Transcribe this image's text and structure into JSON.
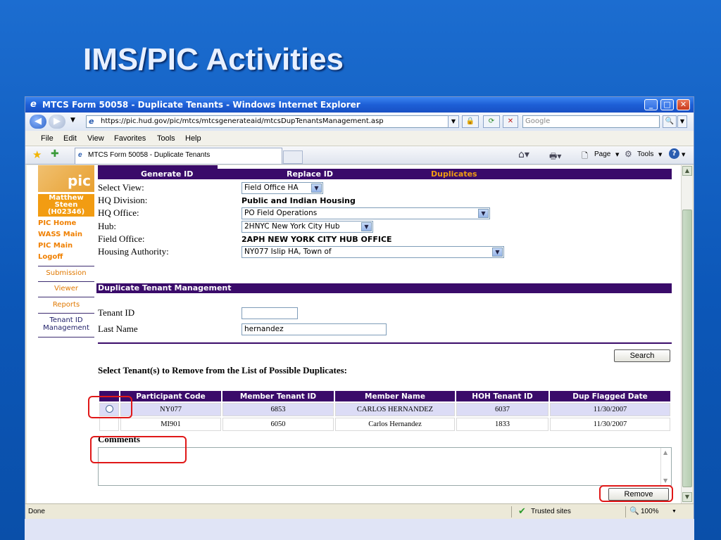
{
  "slide": {
    "title": "IMS/PIC Activities"
  },
  "browser": {
    "window_title": "MTCS Form 50058 - Duplicate Tenants - Windows Internet Explorer",
    "url": "https://pic.hud.gov/pic/mtcs/mtcsgenerateaid/mtcsDupTenantsManagement.asp",
    "search_placeholder": "Google",
    "menu": [
      "File",
      "Edit",
      "View",
      "Favorites",
      "Tools",
      "Help"
    ],
    "tab_title": "MTCS Form 50058 - Duplicate Tenants",
    "toolbar": {
      "page": "Page",
      "tools": "Tools"
    },
    "status": {
      "left": "Done",
      "zone": "Trusted sites",
      "zoom": "100%"
    }
  },
  "page": {
    "logo_text": "pic",
    "user_lines": [
      "Matthew",
      "Steen",
      "(H02346)"
    ],
    "left_links": [
      "PIC Home",
      "WASS Main",
      "PIC Main",
      "Logoff"
    ],
    "sub_nav": [
      "Submission",
      "Viewer",
      "Reports",
      "Tenant ID",
      "Management"
    ],
    "top_tabs": [
      "Generate ID",
      "Replace ID",
      "Duplicates"
    ],
    "filters": {
      "select_view_label": "Select View:",
      "select_view_value": "Field Office HA",
      "hq_division_label": "HQ Division:",
      "hq_division_value": "Public and Indian Housing",
      "hq_office_label": "HQ Office:",
      "hq_office_value": "PO Field Operations",
      "hub_label": "Hub:",
      "hub_value": "2HNYC New York City Hub",
      "field_office_label": "Field Office:",
      "field_office_value": "2APH NEW YORK CITY HUB OFFICE",
      "ha_label": "Housing Authority:",
      "ha_value": "NY077 Islip HA, Town of"
    },
    "section_title": "Duplicate Tenant Management",
    "tenant_id_label": "Tenant ID",
    "tenant_id_value": "",
    "last_name_label": "Last Name",
    "last_name_value": "hernandez",
    "search_button": "Search",
    "select_heading": "Select Tenant(s) to Remove from the List of Possible Duplicates:",
    "table": {
      "headers": [
        "",
        "Participant Code",
        "Member Tenant ID",
        "Member Name",
        "HOH Tenant ID",
        "Dup Flagged Date"
      ],
      "rows": [
        {
          "code": "NY077",
          "member_id": "6853",
          "name": "CARLOS HERNANDEZ",
          "hoh_id": "6037",
          "date": "11/30/2007"
        },
        {
          "code": "MI901",
          "member_id": "6050",
          "name": "Carlos Hernandez",
          "hoh_id": "1833",
          "date": "11/30/2007"
        }
      ]
    },
    "comments_label": "Comments",
    "remove_button": "Remove"
  },
  "colors": {
    "accent_purple": "#3a0b6a",
    "highlight_red": "#e01818",
    "slide_blue": "#1060c8",
    "link_orange": "#f08000"
  }
}
